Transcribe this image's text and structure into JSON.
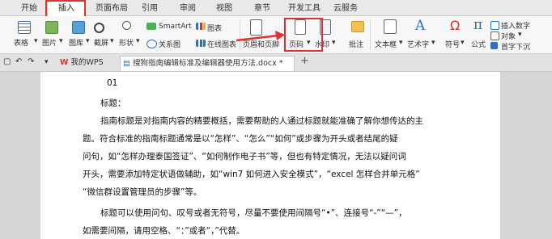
{
  "tabs": [
    "开始",
    "插入",
    "页面布局",
    "引用",
    "审阅",
    "视图",
    "章节",
    "开发工具",
    "云服务"
  ],
  "ribbon": {
    "table": "表格",
    "picture": "图片",
    "gallery": "图库",
    "screenshot": "截屏",
    "shape": "形状",
    "smartart": "SmartArt",
    "chart": "图表",
    "relation": "关系图",
    "online_chart": "在线图表",
    "header_footer": "页眉和页脚",
    "page_number": "页码",
    "watermark": "水印",
    "comment": "批注",
    "textbox": "文本框",
    "wordart": "艺术字",
    "symbol": "符号",
    "formula": "公式",
    "insert_number": "插入数字",
    "object": "对象",
    "dropcap": "首字下沉"
  },
  "doc_tabs": {
    "my_wps": "我的WPS",
    "document": "搜狗指南编辑标准及编辑器使用方法.docx *",
    "add": "+"
  },
  "document": {
    "lines": [
      "01",
      "标题：",
      "指南标题是对指南内容的精要概括，需要帮助的人通过标题就能准确了解你想传达的主",
      "题。符合标准的指南标题通常是以“怎样”、“怎么”“如何”或步骤为开头或者结尾的疑",
      "问句，如“怎样办理泰国签证”、“如何制作电子书”等，但也有特定情况，无法以疑问词",
      "开头，需要添加特定状语做辅助，如“win7 如何进入安全模式”，“excel 怎样合并单元格”",
      "“微信群设置管理员的步骤”等。",
      "标题可以使用问句、叹号或者无符号，尽量不要使用间隔号“•”、连接号“-”“—”，",
      "如需要间隔，请用空格、“：”或者“，”代替。"
    ]
  },
  "colors": {
    "highlight": "#e03030",
    "accent": "#2f6fc4",
    "wps_red": "#d9322b"
  }
}
